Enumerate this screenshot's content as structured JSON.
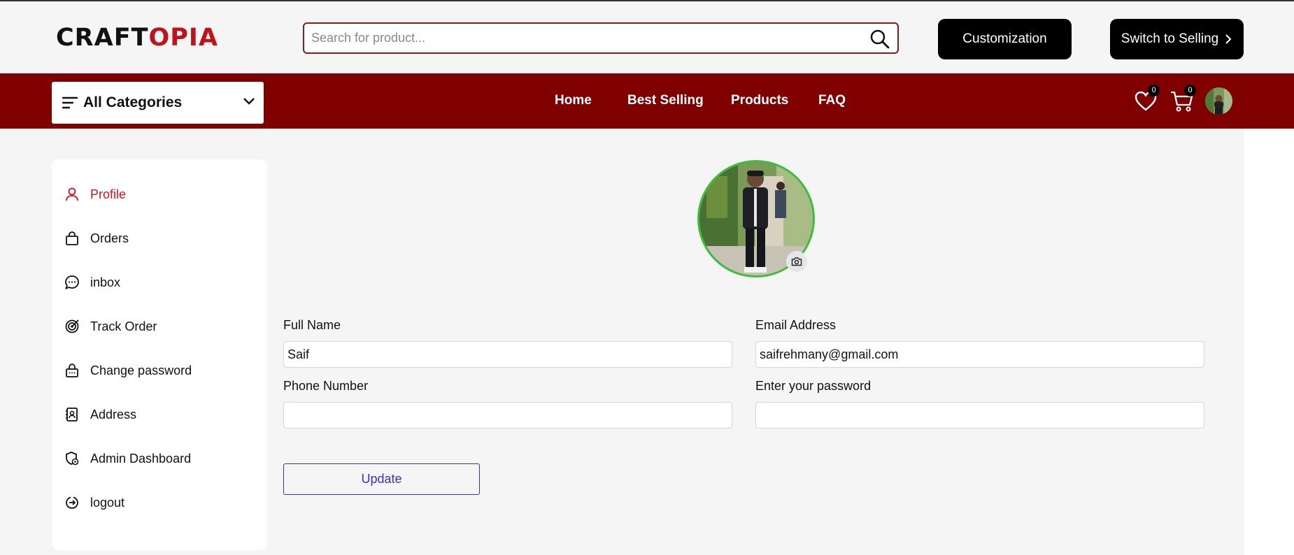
{
  "header": {
    "logo_part1": "CRAFT",
    "logo_part2": "OPIA",
    "search_placeholder": "Search for product...",
    "customization_label": "Customization",
    "switch_selling_label": "Switch to Selling"
  },
  "nav": {
    "categories_label": "All Categories",
    "links": [
      "Home",
      "Best Selling",
      "Products",
      "FAQ"
    ],
    "wishlist_count": "0",
    "cart_count": "0"
  },
  "sidebar": {
    "items": [
      {
        "label": "Profile",
        "icon": "user-icon",
        "active": true
      },
      {
        "label": "Orders",
        "icon": "bag-icon"
      },
      {
        "label": "inbox",
        "icon": "chat-icon"
      },
      {
        "label": "Track Order",
        "icon": "track-icon"
      },
      {
        "label": "Change password",
        "icon": "lock-icon"
      },
      {
        "label": "Address",
        "icon": "address-book-icon"
      },
      {
        "label": "Admin Dashboard",
        "icon": "admin-icon"
      },
      {
        "label": "logout",
        "icon": "logout-icon"
      }
    ]
  },
  "form": {
    "full_name_label": "Full Name",
    "full_name_value": "Saif",
    "email_label": "Email Address",
    "email_value": "saifrehmany@gmail.com",
    "phone_label": "Phone Number",
    "phone_value": "",
    "password_label": "Enter your password",
    "password_value": "",
    "update_label": "Update"
  },
  "colors": {
    "brand_red": "#800000",
    "logo_red": "#c0121b",
    "active_red": "#d0141b",
    "avatar_ring": "#3dbf3d",
    "update_blue": "#3b2fc9"
  }
}
